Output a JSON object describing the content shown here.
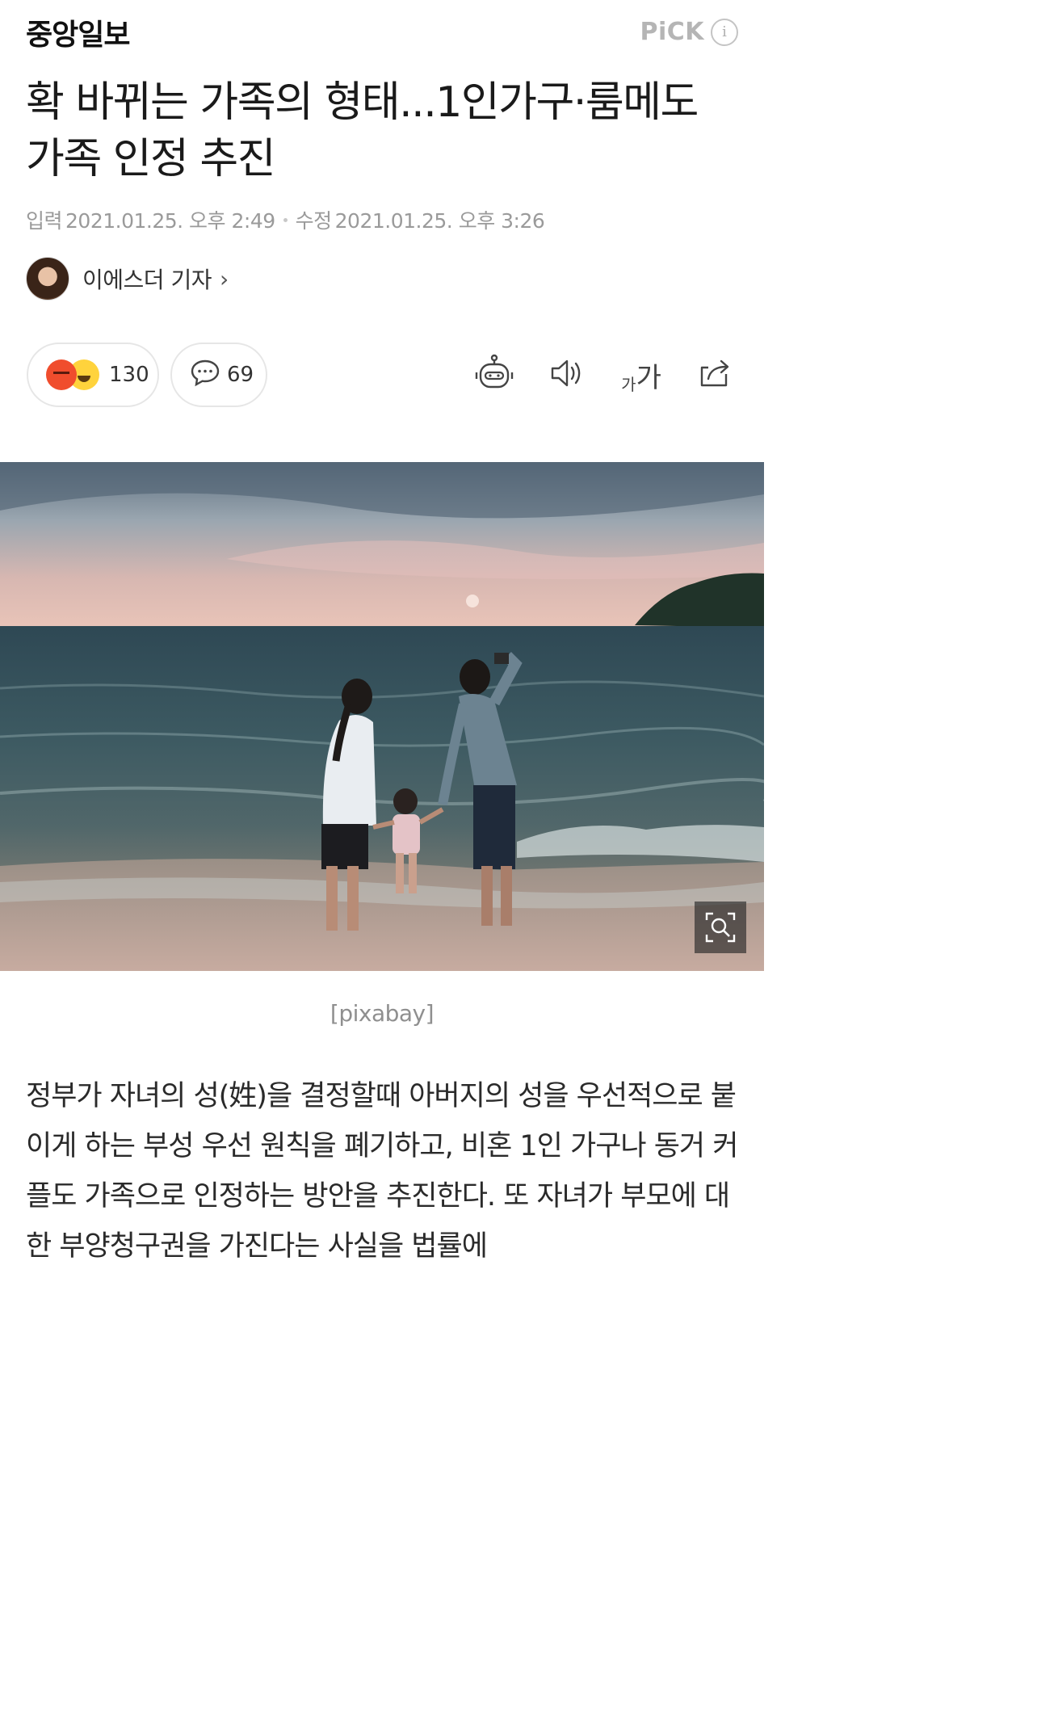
{
  "header": {
    "press_name": "중앙일보",
    "pick_label": "PiCK",
    "info_icon": "info-icon"
  },
  "article": {
    "title": "확 바뀌는 가족의 형태...1인가구·룸메도 가족 인정 추진",
    "published_label": "입력",
    "published": "2021.01.25. 오후 2:49",
    "modified_label": "수정",
    "modified": "2021.01.25. 오후 3:26",
    "author": "이에스더 기자",
    "photo_caption": "[pixabay]",
    "body": "정부가 자녀의 성(姓)을 결정할때 아버지의 성을 우선적으로 붙이게 하는 부성 우선 원칙을 폐기하고, 비혼 1인 가구나 동거 커플도 가족으로 인정하는 방안을 추진한다. 또 자녀가 부모에 대한 부양청구권을 가진다는 사실을 법률에"
  },
  "actions": {
    "reaction_count": "130",
    "comment_count": "69",
    "font_small": "가",
    "font_big": "가",
    "icons": [
      "robot-summary-icon",
      "speaker-icon",
      "font-size-icon",
      "share-icon"
    ]
  },
  "colors": {
    "accent_angry": "#f04d2d",
    "accent_laugh": "#ffd33c",
    "muted_text": "#9a9a9a"
  }
}
